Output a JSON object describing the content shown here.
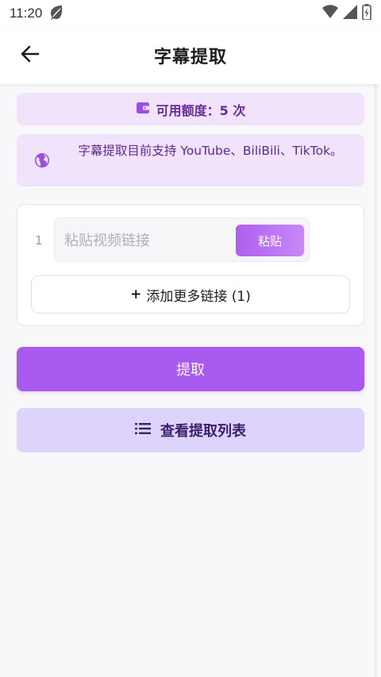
{
  "status_bar": {
    "time": "11:20",
    "icons": [
      "leaf-icon",
      "wifi-icon",
      "cellular-signal-icon",
      "battery-icon"
    ]
  },
  "header": {
    "back_icon": "arrow-left-icon",
    "title": "字幕提取"
  },
  "quota": {
    "icon": "wallet-icon",
    "text": "可用额度：5 次"
  },
  "notice": {
    "icon": "globe-icon",
    "text": "字幕提取目前支持 YouTube、BiliBili、TikTok。"
  },
  "links": {
    "rows": [
      {
        "index": "1",
        "placeholder": "粘贴视频链接",
        "value": "",
        "paste_label": "粘贴"
      }
    ],
    "add_more_label": "添加更多链接 (1)",
    "add_more_prefix": "+"
  },
  "actions": {
    "extract_label": "提取",
    "view_list_label": "查看提取列表",
    "view_list_icon": "list-icon"
  },
  "colors": {
    "accent": "#a95bf0",
    "banner_bg": "#f1e3fc",
    "secondary_button_bg": "#ded3fb",
    "background": "#f8f8fb"
  }
}
